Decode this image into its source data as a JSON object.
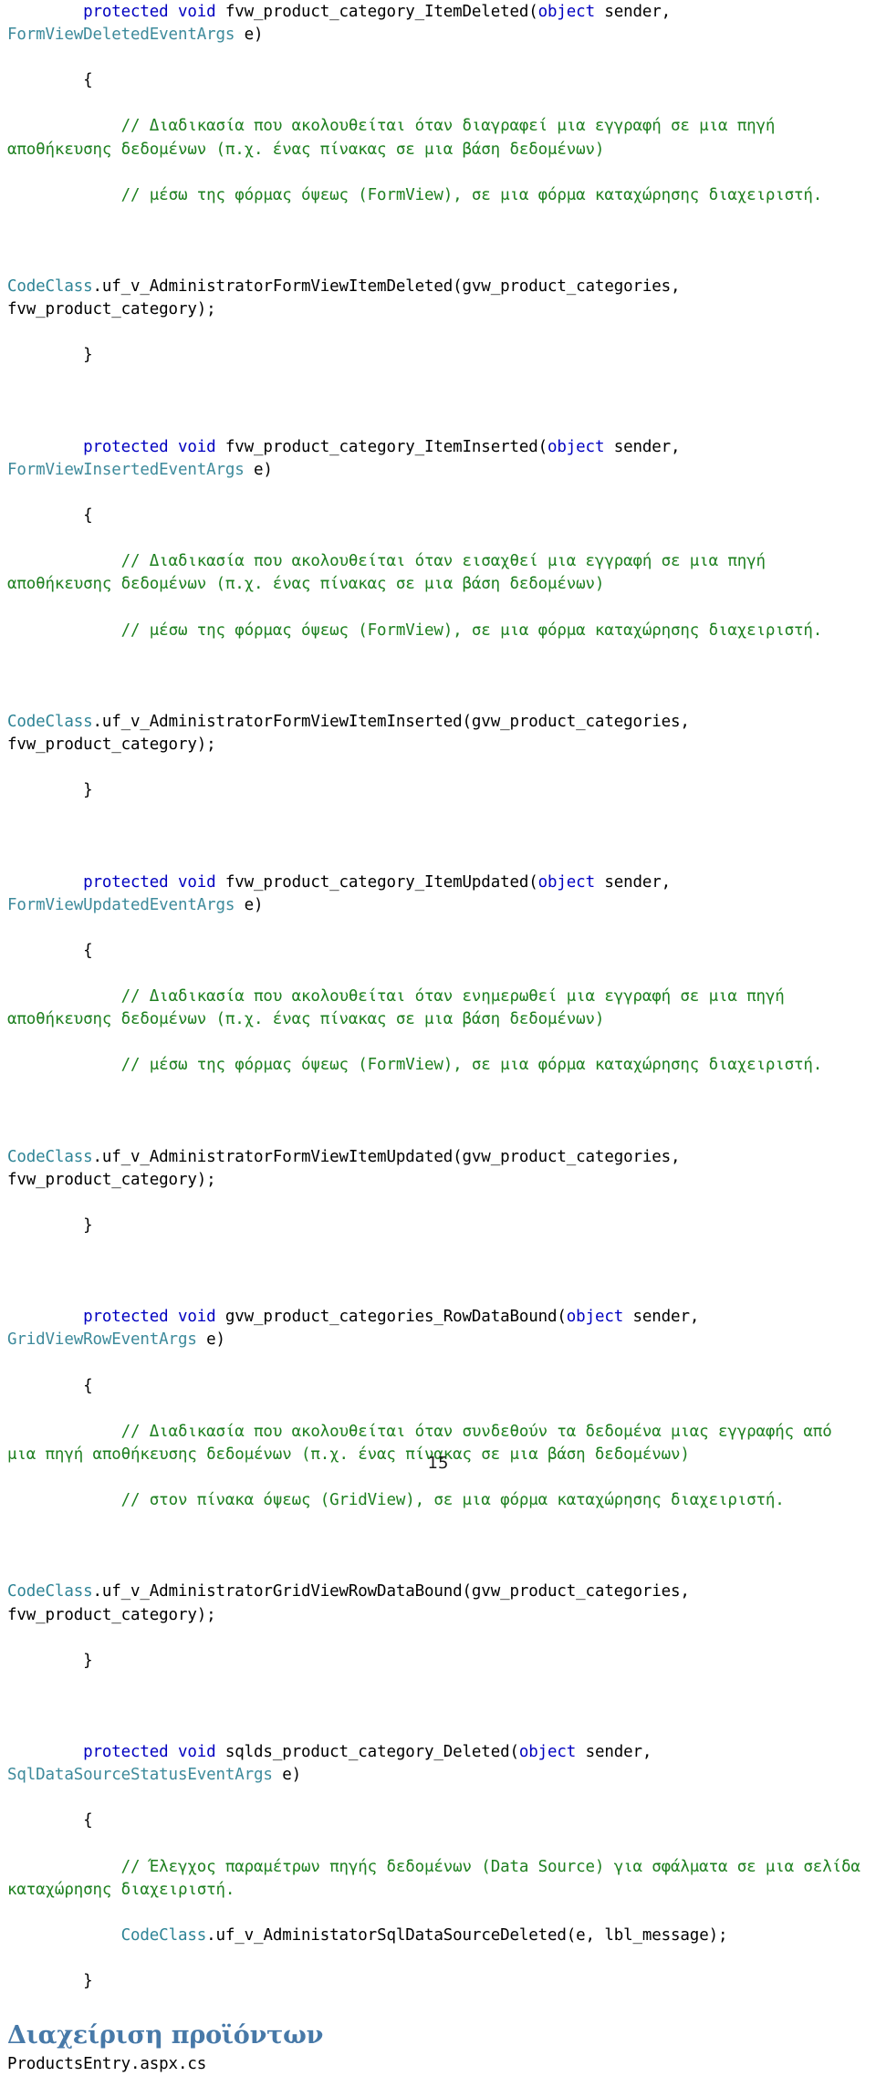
{
  "document": {
    "page_number": "15",
    "colors": {
      "keyword": "#0000C0",
      "type": "#3D8A9B",
      "class": "#2E8496",
      "comment": "#1E8020",
      "identifier": "#000000",
      "heading": "#4779A8",
      "background": "#FFFFFF"
    },
    "code_lines": [
      [
        {
          "t": "        ",
          "c": "plain"
        },
        {
          "t": "protected void ",
          "c": "kw"
        },
        {
          "t": "fvw_product_category_ItemDeleted(",
          "c": "plain"
        },
        {
          "t": "object",
          "c": "kw"
        },
        {
          "t": " sender, ",
          "c": "plain"
        },
        {
          "t": "FormViewDeletedEventArgs",
          "c": "type"
        },
        {
          "t": " e)",
          "c": "plain"
        }
      ],
      [
        {
          "t": "        {",
          "c": "plain"
        }
      ],
      [
        {
          "t": "            // Διαδικασία που ακολουθείται όταν διαγραφεί μια εγγραφή σε μια πηγή αποθήκευσης δεδομένων (π.χ. ένας πίνακας σε μια βάση δεδομένων)",
          "c": "cmt"
        }
      ],
      [
        {
          "t": "            // μέσω της φόρμας όψεως (FormView), σε μια φόρμα καταχώρησης διαχειριστή.",
          "c": "cmt"
        }
      ],
      [
        {
          "t": "",
          "c": "plain"
        }
      ],
      [
        {
          "t": "CodeClass",
          "c": "cls"
        },
        {
          "t": ".uf_v_AdministratorFormViewItemDeleted(gvw_product_categories, fvw_product_category);",
          "c": "plain"
        }
      ],
      [
        {
          "t": "        }",
          "c": "plain"
        }
      ],
      [
        {
          "t": "",
          "c": "plain"
        }
      ],
      [
        {
          "t": "        ",
          "c": "plain"
        },
        {
          "t": "protected void ",
          "c": "kw"
        },
        {
          "t": "fvw_product_category_ItemInserted(",
          "c": "plain"
        },
        {
          "t": "object",
          "c": "kw"
        },
        {
          "t": " sender, ",
          "c": "plain"
        },
        {
          "t": "FormViewInsertedEventArgs",
          "c": "type"
        },
        {
          "t": " e)",
          "c": "plain"
        }
      ],
      [
        {
          "t": "        {",
          "c": "plain"
        }
      ],
      [
        {
          "t": "            // Διαδικασία που ακολουθείται όταν εισαχθεί μια εγγραφή σε μια πηγή αποθήκευσης δεδομένων (π.χ. ένας πίνακας σε μια βάση δεδομένων)",
          "c": "cmt"
        }
      ],
      [
        {
          "t": "            // μέσω της φόρμας όψεως (FormView), σε μια φόρμα καταχώρησης διαχειριστή.",
          "c": "cmt"
        }
      ],
      [
        {
          "t": "",
          "c": "plain"
        }
      ],
      [
        {
          "t": "CodeClass",
          "c": "cls"
        },
        {
          "t": ".uf_v_AdministratorFormViewItemInserted(gvw_product_categories, fvw_product_category);",
          "c": "plain"
        }
      ],
      [
        {
          "t": "        }",
          "c": "plain"
        }
      ],
      [
        {
          "t": "",
          "c": "plain"
        }
      ],
      [
        {
          "t": "        ",
          "c": "plain"
        },
        {
          "t": "protected void ",
          "c": "kw"
        },
        {
          "t": "fvw_product_category_ItemUpdated(",
          "c": "plain"
        },
        {
          "t": "object",
          "c": "kw"
        },
        {
          "t": " sender, ",
          "c": "plain"
        },
        {
          "t": "FormViewUpdatedEventArgs",
          "c": "type"
        },
        {
          "t": " e)",
          "c": "plain"
        }
      ],
      [
        {
          "t": "        {",
          "c": "plain"
        }
      ],
      [
        {
          "t": "            // Διαδικασία που ακολουθείται όταν ενημερωθεί μια εγγραφή σε μια πηγή αποθήκευσης δεδομένων (π.χ. ένας πίνακας σε μια βάση δεδομένων)",
          "c": "cmt"
        }
      ],
      [
        {
          "t": "            // μέσω της φόρμας όψεως (FormView), σε μια φόρμα καταχώρησης διαχειριστή.",
          "c": "cmt"
        }
      ],
      [
        {
          "t": "",
          "c": "plain"
        }
      ],
      [
        {
          "t": "CodeClass",
          "c": "cls"
        },
        {
          "t": ".uf_v_AdministratorFormViewItemUpdated(gvw_product_categories, fvw_product_category);",
          "c": "plain"
        }
      ],
      [
        {
          "t": "        }",
          "c": "plain"
        }
      ],
      [
        {
          "t": "",
          "c": "plain"
        }
      ],
      [
        {
          "t": "        ",
          "c": "plain"
        },
        {
          "t": "protected void ",
          "c": "kw"
        },
        {
          "t": "gvw_product_categories_RowDataBound(",
          "c": "plain"
        },
        {
          "t": "object",
          "c": "kw"
        },
        {
          "t": " sender, ",
          "c": "plain"
        },
        {
          "t": "GridViewRowEventArgs",
          "c": "type"
        },
        {
          "t": " e)",
          "c": "plain"
        }
      ],
      [
        {
          "t": "        {",
          "c": "plain"
        }
      ],
      [
        {
          "t": "            // Διαδικασία που ακολουθείται όταν συνδεθούν τα δεδομένα μιας εγγραφής από μια πηγή αποθήκευσης δεδομένων (π.χ. ένας πίνακας σε μια βάση δεδομένων)",
          "c": "cmt"
        }
      ],
      [
        {
          "t": "            // στον πίνακα όψεως (GridView), σε μια φόρμα καταχώρησης διαχειριστή.",
          "c": "cmt"
        }
      ],
      [
        {
          "t": "",
          "c": "plain"
        }
      ],
      [
        {
          "t": "CodeClass",
          "c": "cls"
        },
        {
          "t": ".uf_v_AdministratorGridViewRowDataBound(gvw_product_categories, fvw_product_category);",
          "c": "plain"
        }
      ],
      [
        {
          "t": "        }",
          "c": "plain"
        }
      ],
      [
        {
          "t": "",
          "c": "plain"
        }
      ],
      [
        {
          "t": "        ",
          "c": "plain"
        },
        {
          "t": "protected void ",
          "c": "kw"
        },
        {
          "t": "sqlds_product_category_Deleted(",
          "c": "plain"
        },
        {
          "t": "object",
          "c": "kw"
        },
        {
          "t": " sender, ",
          "c": "plain"
        },
        {
          "t": "SqlDataSourceStatusEventArgs",
          "c": "type"
        },
        {
          "t": " e)",
          "c": "plain"
        }
      ],
      [
        {
          "t": "        {",
          "c": "plain"
        }
      ],
      [
        {
          "t": "            // Έλεγχος παραμέτρων πηγής δεδομένων (Data Source) για σφάλματα σε μια σελίδα καταχώρησης διαχειριστή.",
          "c": "cmt"
        }
      ],
      [
        {
          "t": "            ",
          "c": "plain"
        },
        {
          "t": "CodeClass",
          "c": "cls"
        },
        {
          "t": ".uf_v_AdministatorSqlDataSourceDeleted(e, lbl_message);",
          "c": "plain"
        }
      ],
      [
        {
          "t": "        }",
          "c": "plain"
        }
      ]
    ],
    "section": {
      "heading": "Διαχείριση προϊόντων",
      "file_name": "ProductsEntry.aspx.cs"
    }
  }
}
